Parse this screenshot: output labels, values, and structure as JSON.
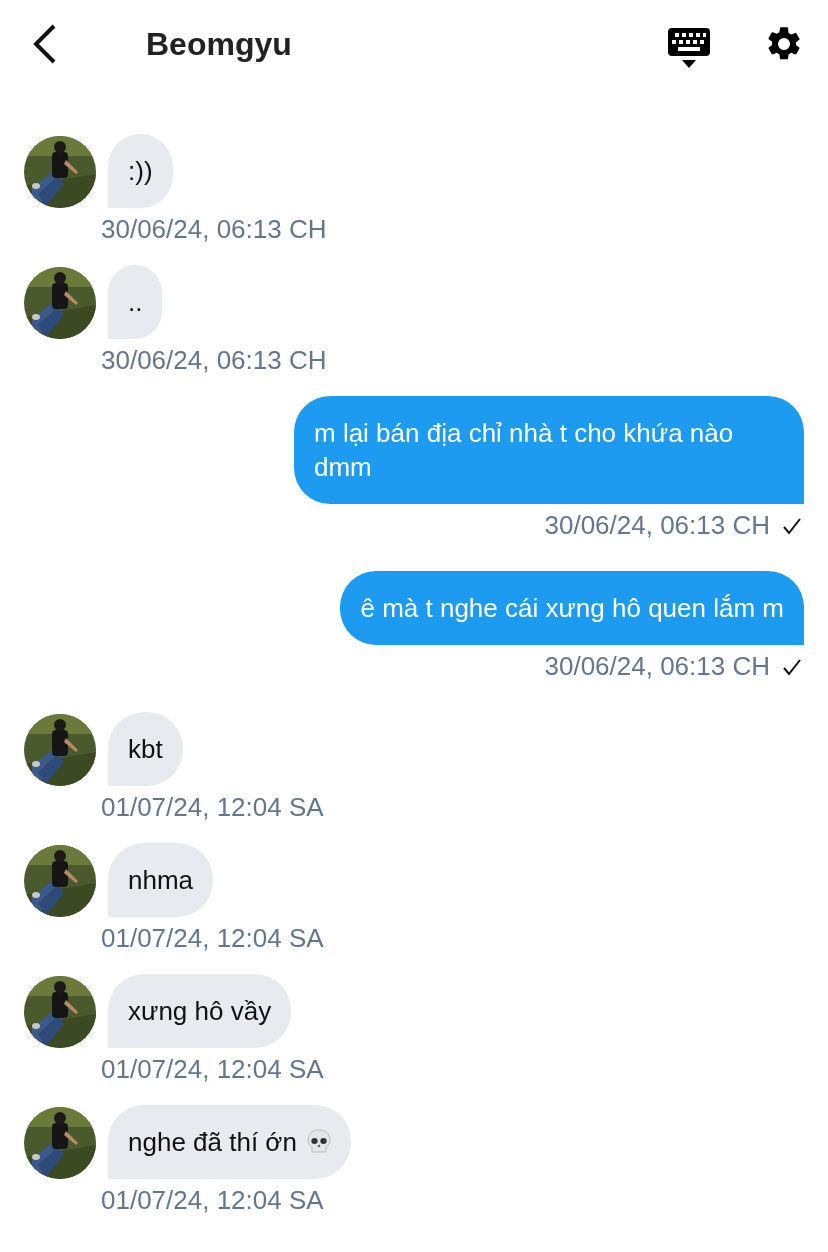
{
  "header": {
    "title": "Beomgyu"
  },
  "messages": [
    {
      "kind": "incoming",
      "text": ":))",
      "time": "30/06/24, 06:13 CH",
      "read_tick": false
    },
    {
      "kind": "incoming",
      "text": "..",
      "time": "30/06/24, 06:13 CH",
      "read_tick": false
    },
    {
      "kind": "outgoing",
      "text": "m lại bán địa chỉ nhà t cho khứa nào dmm",
      "time": "30/06/24, 06:13 CH",
      "read_tick": true
    },
    {
      "kind": "outgoing",
      "text": "ê mà t nghe cái xưng hô quen lắm m",
      "time": "30/06/24, 06:13 CH",
      "read_tick": true
    },
    {
      "kind": "incoming",
      "text": "kbt",
      "time": "01/07/24, 12:04 SA",
      "read_tick": false
    },
    {
      "kind": "incoming",
      "text": "nhma",
      "time": "01/07/24, 12:04 SA",
      "read_tick": false
    },
    {
      "kind": "incoming",
      "text": "xưng hô vầy",
      "time": "01/07/24, 12:04 SA",
      "read_tick": false
    },
    {
      "kind": "incoming_emoji",
      "text": "nghe đã thí ớn",
      "time": "01/07/24, 12:04 SA",
      "read_tick": false
    }
  ]
}
